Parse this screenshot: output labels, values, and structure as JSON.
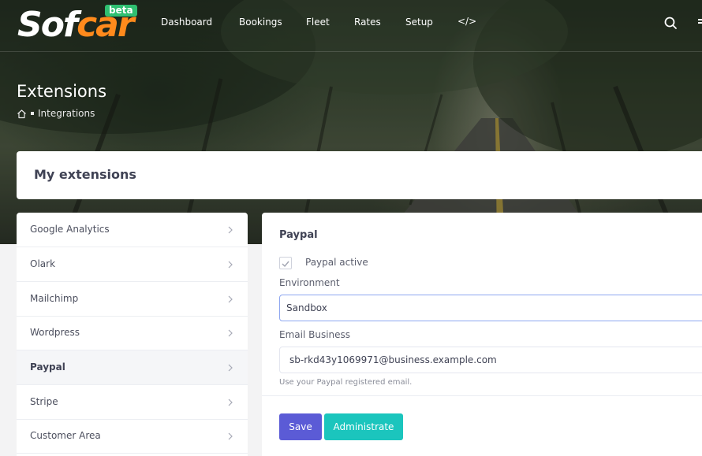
{
  "brand": {
    "logo_part1": "Sof",
    "logo_part2": "car",
    "badge": "beta",
    "accent_color": "#ff8a1c",
    "badge_color": "#2fbf71"
  },
  "nav": {
    "items": [
      {
        "label": "Dashboard"
      },
      {
        "label": "Bookings"
      },
      {
        "label": "Fleet"
      },
      {
        "label": "Rates"
      },
      {
        "label": "Setup"
      }
    ],
    "code_label": "</>",
    "icons": [
      "code-icon",
      "search-icon"
    ]
  },
  "header": {
    "title": "Extensions",
    "breadcrumb": "Integrations",
    "breadcrumb_icon": "home-icon"
  },
  "extensions_card": {
    "title": "My extensions"
  },
  "sidebar": {
    "items": [
      {
        "label": "Google Analytics",
        "active": false
      },
      {
        "label": "Olark",
        "active": false
      },
      {
        "label": "Mailchimp",
        "active": false
      },
      {
        "label": "Wordpress",
        "active": false
      },
      {
        "label": "Paypal",
        "active": true
      },
      {
        "label": "Stripe",
        "active": false
      },
      {
        "label": "Customer Area",
        "active": false
      }
    ]
  },
  "panel": {
    "title": "Paypal",
    "active_checkbox": {
      "label": "Paypal active",
      "checked": true
    },
    "environment": {
      "label": "Environment",
      "value": "Sandbox"
    },
    "email": {
      "label": "Email Business",
      "value": "sb-rkd43y1069971@business.example.com",
      "help": "Use your Paypal registered email."
    },
    "buttons": {
      "save": "Save",
      "administrate": "Administrate",
      "save_color": "#5b5bd6",
      "administrate_color": "#1bc5bd"
    }
  }
}
